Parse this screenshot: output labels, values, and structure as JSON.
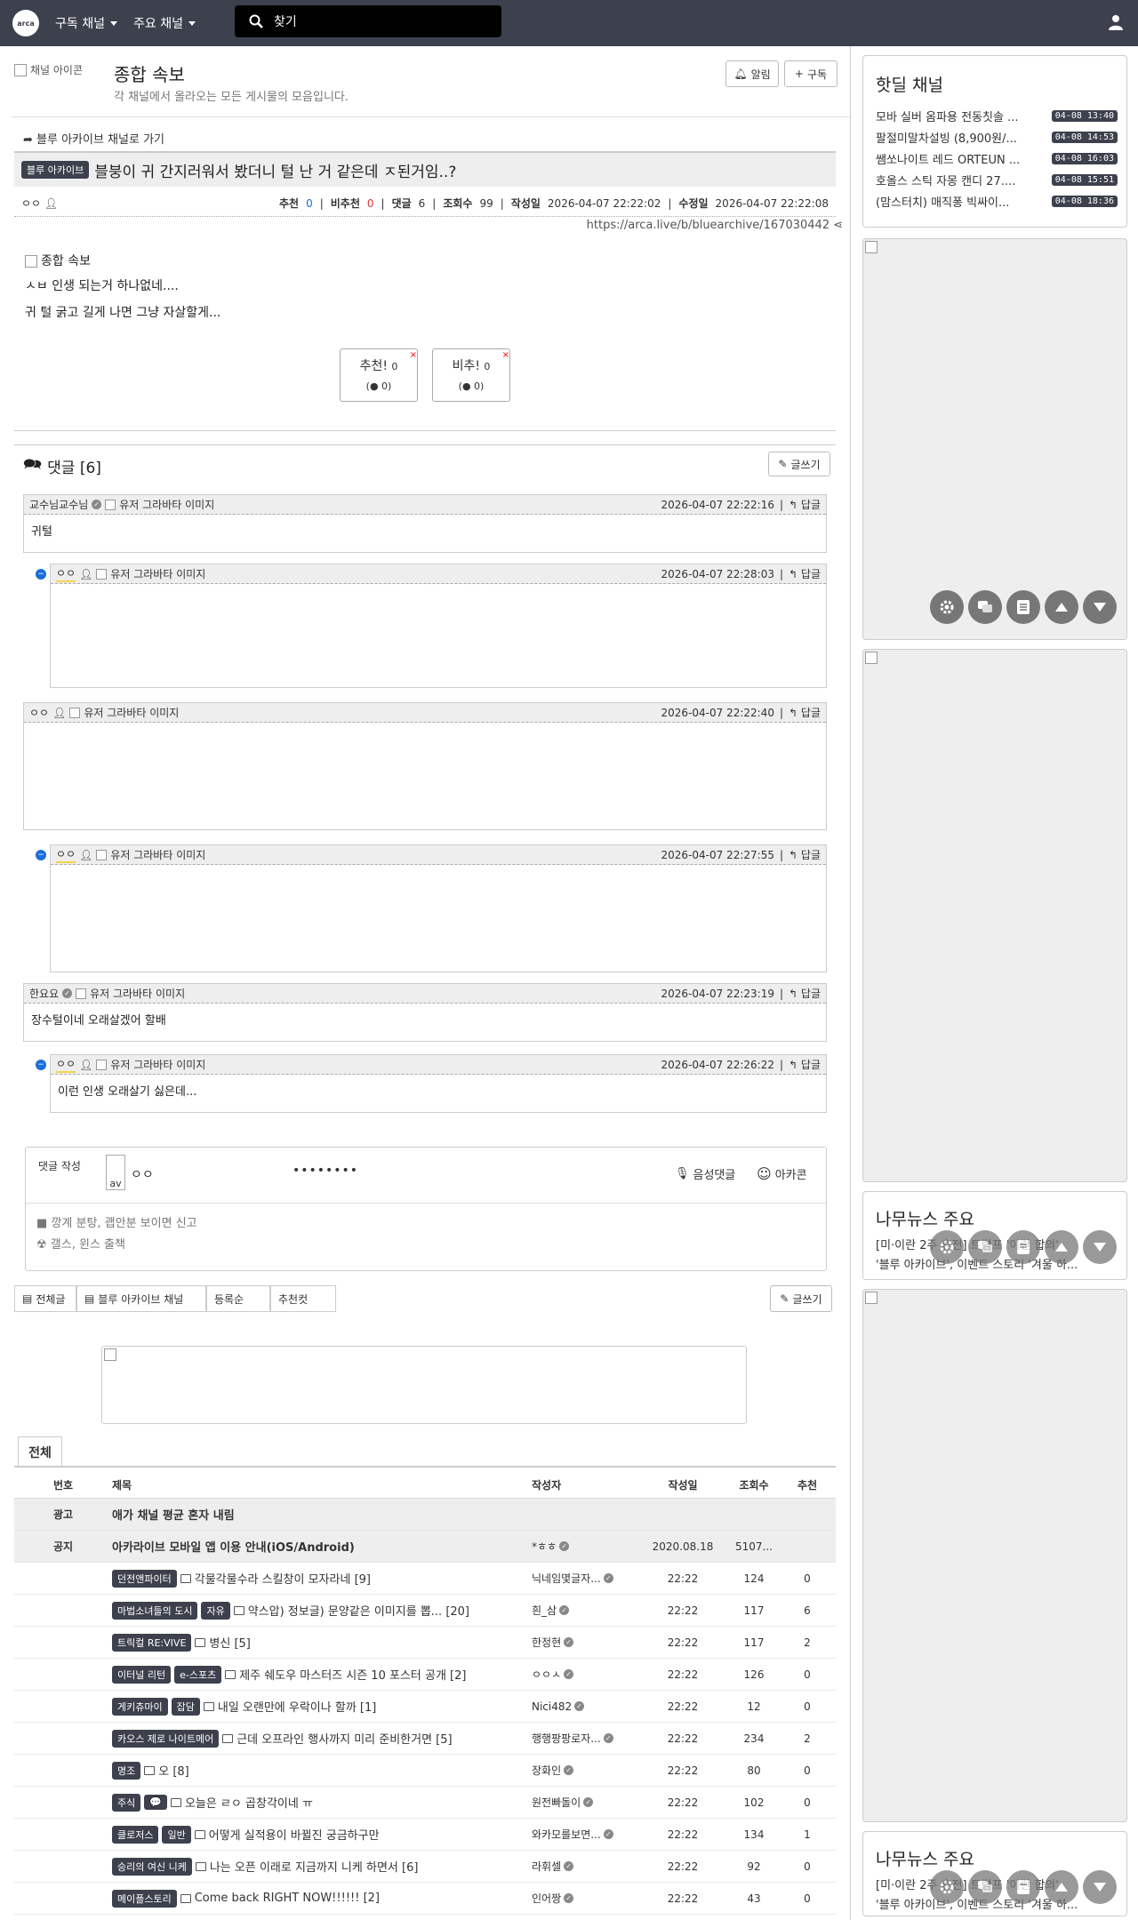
{
  "navbar": {
    "logo": "arca",
    "subscribed": "구독 채널",
    "main_channels": "주요 채널",
    "search_placeholder": "찾기"
  },
  "channel": {
    "img_alt": "채널 아이콘",
    "title": "종합 속보",
    "desc": "각 채널에서 올라오는 모든 게시물의 모음입니다.",
    "alarm": "알림",
    "subscribe": "구독"
  },
  "post": {
    "back_link": "블루 아카이브 채널로 가기",
    "category": "블루 아카이브",
    "title": "블붕이 귀 간지러워서 봤더니 털 난 거 같은데 ㅈ된거임..?",
    "author": "ㅇㅇ",
    "meta": {
      "rec_label": "추천",
      "rec": "0",
      "nrec_label": "비추천",
      "nrec": "0",
      "cmt_label": "댓글",
      "cmt": "6",
      "view_label": "조회수",
      "view": "99",
      "date_label": "작성일",
      "date": "2026-04-07 22:22:02",
      "mod_label": "수정일",
      "mod": "2026-04-07 22:22:08"
    },
    "url": "https://arca.live/b/bluearchive/167030442",
    "img_alt": "종합 속보",
    "body1": "ㅅㅂ 인생 되는거 하나없네....",
    "body2": "귀 털 굵고 길게 나면 그냥 자살할게...",
    "vote_up": "추천!",
    "vote_up_n": "0",
    "vote_up_sub": "0",
    "vote_down": "비추!",
    "vote_down_n": "0",
    "vote_down_sub": "0"
  },
  "comments": {
    "header": "댓글 [6]",
    "write": "글쓰기",
    "reply_label": "답글",
    "avatar_alt": "유저 그라바타 이미지",
    "items": [
      {
        "author": "교수님교수님",
        "date": "2026-04-07 22:22:16",
        "text": "귀털"
      },
      {
        "author": "ㅇㅇ",
        "date": "2026-04-07 22:28:03",
        "text": ""
      },
      {
        "author": "ㅇㅇ",
        "date": "2026-04-07 22:22:40",
        "text": ""
      },
      {
        "author": "ㅇㅇ",
        "date": "2026-04-07 22:27:55",
        "text": ""
      },
      {
        "author": "한요요",
        "date": "2026-04-07 22:23:19",
        "text": "장수털이네 오래살겠어 할배"
      },
      {
        "author": "ㅇㅇ",
        "date": "2026-04-07 22:26:22",
        "text": "이런 인생 오래살기 싫은데..."
      }
    ]
  },
  "comment_form": {
    "label": "댓글 작성",
    "avatar": "av",
    "name": "ㅇㅇ",
    "password": "••••••••",
    "voice": "음성댓글",
    "emoticon": "아카콘",
    "notice1": "깡계 분탕, 괩안분 보이면 신고",
    "notice2": "갤스, 윈스 출책"
  },
  "filters": {
    "all": "전체글",
    "channel": "블루 아카이브 채널",
    "order": "등록순",
    "best": "추천컷",
    "write": "글쓰기"
  },
  "board": {
    "tab": "전체",
    "headers": {
      "no": "번호",
      "title": "제목",
      "author": "작성자",
      "date": "작성일",
      "views": "조회수",
      "rec": "추천"
    },
    "rows": [
      {
        "no": "광고",
        "title": "애가 채널 평균 혼자 내림",
        "author": "",
        "date": "",
        "views": "",
        "rec": "",
        "hl": true
      },
      {
        "no": "공지",
        "title": "아카라이브 모바일 앱 이용 안내(iOS/Android)",
        "author": "*ㅎㅎ",
        "date": "2020.08.18",
        "views": "5107...",
        "rec": "",
        "hl": true
      },
      {
        "no": "",
        "badge": "던전앤파이터",
        "title": "각물각물수라 스킬창이 모자라네 [9]",
        "author": "닉네임몇글자...",
        "date": "22:22",
        "views": "124",
        "rec": "0"
      },
      {
        "no": "",
        "badge": "마법소녀들의 도시",
        "badge2": "자유",
        "title": "약스압) 정보글) 문양같은 이미지를 뽑... [20]",
        "author": "흰_삼",
        "date": "22:22",
        "views": "117",
        "rec": "6"
      },
      {
        "no": "",
        "badge": "트릭컬 RE:VIVE",
        "title": "병신 [5]",
        "author": "한정현",
        "date": "22:22",
        "views": "117",
        "rec": "2"
      },
      {
        "no": "",
        "badge": "이터널 리턴",
        "badge2": "e-스포츠",
        "title": "제주 쉐도우 마스터즈 시즌 10 포스터 공개 [2]",
        "author": "ㅇㅇㅅ",
        "date": "22:22",
        "views": "126",
        "rec": "0"
      },
      {
        "no": "",
        "badge": "게키츄마이",
        "badge2": "잡담",
        "title": "내일 오랜만에 우락이나 할까 [1]",
        "author": "Nici482",
        "date": "22:22",
        "views": "12",
        "rec": "0"
      },
      {
        "no": "",
        "badge": "카오스 제로 나이트메어",
        "title": "근데 오프라인 행사까지 미리 준비한거면 [5]",
        "author": "행행팡팡로자...",
        "date": "22:22",
        "views": "234",
        "rec": "2"
      },
      {
        "no": "",
        "badge": "명조",
        "title": "오 [8]",
        "author": "장화인",
        "date": "22:22",
        "views": "80",
        "rec": "0"
      },
      {
        "no": "",
        "badge": "주식",
        "badge2": "💬",
        "title": "오늘은 ㄹㅇ 곱창각이네 ㅠ",
        "author": "원전빠돌이",
        "date": "22:22",
        "views": "102",
        "rec": "0"
      },
      {
        "no": "",
        "badge": "클로저스",
        "badge2": "일반",
        "title": "어떻게 실적용이 바뀔진 궁금하구만",
        "author": "와카모를보면...",
        "date": "22:22",
        "views": "134",
        "rec": "1"
      },
      {
        "no": "",
        "badge": "승리의 여신 니케",
        "title": "나는 오픈 이래로 지금까지 니케 하면서 [6]",
        "author": "라휘셀",
        "date": "22:22",
        "views": "92",
        "rec": "0"
      },
      {
        "no": "",
        "badge": "메이플스토리",
        "title": "Come back RIGHT NOW!!!!!! [2]",
        "author": "인어짱",
        "date": "22:22",
        "views": "43",
        "rec": "0"
      }
    ]
  },
  "sidebar": {
    "hotdeal_title": "핫딜 채널",
    "hotdeal": [
      {
        "t": "모바 실버 옴파용 전동칫솔 ...",
        "time": "04-08 13:40"
      },
      {
        "t": "팔절미말차설빙 (8,900원/...",
        "time": "04-08 14:53"
      },
      {
        "t": "쌤쏘나이트 레드 ORTEUN ...",
        "time": "04-08 16:03"
      },
      {
        "t": "호올스 스틱 자몽 캔디 27....",
        "time": "04-08 15:51"
      },
      {
        "t": "(맘스터치) 매직퐁 빅싸이...",
        "time": "04-08 18:36"
      }
    ],
    "news_title": "나무뉴스 주요",
    "news_line1": "[미·이란 2주 휴전] 트럼프 '이란 합의'",
    "news_line2": "'블루 아카이브', 이벤트 스토리 '겨울 하..."
  }
}
